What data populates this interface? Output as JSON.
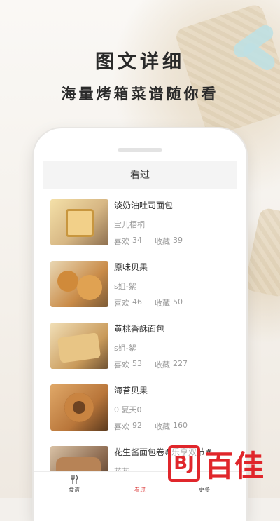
{
  "hero": {
    "title": "图文详细",
    "subtitle": "海量烤箱菜谱随你看"
  },
  "screen": {
    "header_title": "看过",
    "recipes": [
      {
        "title": "淡奶油吐司面包",
        "author": "宝儿梧桐",
        "likes_label": "喜欢",
        "likes": "34",
        "favs_label": "收藏",
        "favs": "39",
        "thumb_color": "#d7b784",
        "thumb_accent": "#f4e0a8"
      },
      {
        "title": "原味贝果",
        "author": "s姐-絮",
        "likes_label": "喜欢",
        "likes": "46",
        "favs_label": "收藏",
        "favs": "50",
        "thumb_color": "#c98b48",
        "thumb_accent": "#e6c08a"
      },
      {
        "title": "黄桃香酥面包",
        "author": "s姐-絮",
        "likes_label": "喜欢",
        "likes": "53",
        "favs_label": "收藏",
        "favs": "227",
        "thumb_color": "#c99a5a",
        "thumb_accent": "#f1dfb7"
      },
      {
        "title": "海苔贝果",
        "author": "0 夏天0",
        "likes_label": "喜欢",
        "likes": "92",
        "favs_label": "收藏",
        "favs": "160",
        "thumb_color": "#b9763a",
        "thumb_accent": "#e0a868"
      },
      {
        "title": "花生酱面包卷#乐享双节#",
        "author": "花花",
        "likes_label": "",
        "likes": "",
        "favs_label": "",
        "favs": "",
        "thumb_color": "#8c6a50",
        "thumb_accent": "#d9c2a5"
      }
    ]
  },
  "tabbar": {
    "items": [
      {
        "label": "食谱",
        "icon": "fork-knife-icon",
        "active": false
      },
      {
        "label": "看过",
        "icon": "eye-icon",
        "active": true
      },
      {
        "label": "更多",
        "icon": "more-icon",
        "active": false
      }
    ]
  },
  "watermark": {
    "mark": "BJ",
    "text": "百佳"
  },
  "colors": {
    "accent": "#d92c2c",
    "watermark": "#e0262b"
  }
}
